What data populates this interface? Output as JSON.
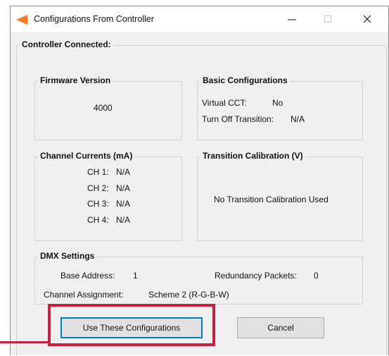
{
  "window": {
    "title": "Configurations From Controller"
  },
  "titlebar_icons": [
    "app-icon",
    "minimize-icon",
    "maximize-icon",
    "close-icon"
  ],
  "status": {
    "label": "Controller Connected:"
  },
  "firmware": {
    "title": "Firmware Version",
    "value": "4000"
  },
  "basic": {
    "title": "Basic Configurations",
    "virtual_cct_label": "Virtual CCT:",
    "virtual_cct_value": "No",
    "turn_off_label": "Turn Off Transition:",
    "turn_off_value": "N/A"
  },
  "channels": {
    "title": "Channel Currents (mA)",
    "items": [
      {
        "label": "CH 1:",
        "value": "N/A"
      },
      {
        "label": "CH 2:",
        "value": "N/A"
      },
      {
        "label": "CH 3:",
        "value": "N/A"
      },
      {
        "label": "CH 4:",
        "value": "N/A"
      }
    ]
  },
  "transition": {
    "title": "Transition Calibration (V)",
    "message": "No Transition Calibration Used"
  },
  "dmx": {
    "title": "DMX Settings",
    "base_address_label": "Base Address:",
    "base_address_value": "1",
    "redundancy_label": "Redundancy Packets:",
    "redundancy_value": "0",
    "channel_assignment_label": "Channel Assignment:",
    "channel_assignment_value": "Scheme 2 (R-G-B-W)"
  },
  "buttons": {
    "use": "Use These Configurations",
    "cancel": "Cancel"
  },
  "colors": {
    "accent": "#f47b20",
    "focus": "#0078d7",
    "callout": "#c8213f",
    "dialog_bg": "#f0f0f0"
  }
}
